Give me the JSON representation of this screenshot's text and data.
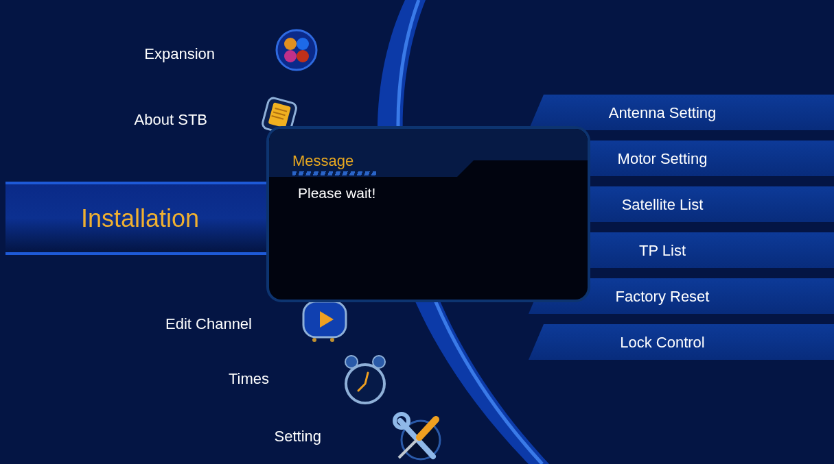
{
  "main_menu": [
    {
      "label": "Expansion",
      "selected": false
    },
    {
      "label": "About STB",
      "selected": false
    },
    {
      "label": "Installation",
      "selected": true
    },
    {
      "label": "Edit Channel",
      "selected": false
    },
    {
      "label": "Times",
      "selected": false
    },
    {
      "label": "Setting",
      "selected": false
    }
  ],
  "submenu": [
    {
      "label": "Antenna Setting"
    },
    {
      "label": "Motor Setting"
    },
    {
      "label": "Satellite List"
    },
    {
      "label": "TP List"
    },
    {
      "label": "Factory Reset"
    },
    {
      "label": "Lock Control"
    }
  ],
  "dialog": {
    "title": "Message",
    "text": "Please wait!"
  }
}
